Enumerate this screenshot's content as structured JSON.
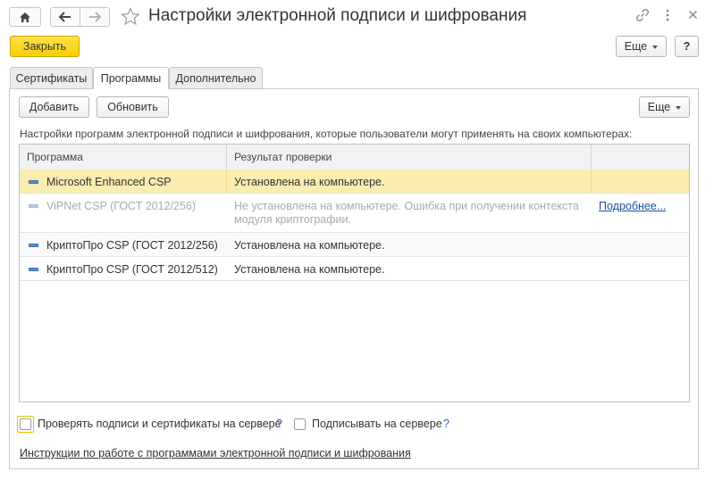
{
  "window": {
    "title": "Настройки электронной подписи и шифрования",
    "close_button": "Закрыть",
    "more_button": "Еще",
    "help_button": "?"
  },
  "tabs": [
    {
      "label": "Сертификаты",
      "active": false
    },
    {
      "label": "Программы",
      "active": true
    },
    {
      "label": "Дополнительно",
      "active": false
    }
  ],
  "toolbar": {
    "add_label": "Добавить",
    "refresh_label": "Обновить",
    "more_label": "Еще"
  },
  "description": "Настройки программ электронной подписи и шифрования, которые пользователи могут применять на своих компьютерах:",
  "table": {
    "columns": [
      "Программа",
      "Результат проверки",
      ""
    ],
    "rows": [
      {
        "program": "Microsoft Enhanced CSP",
        "result": "Установлена на компьютере.",
        "link": "",
        "selected": true,
        "dim": false
      },
      {
        "program": "ViPNet CSP (ГОСТ 2012/256)",
        "result": "Не установлена на компьютере. Ошибка при получении контекста модуля криптографии.",
        "link": "Подробнее...",
        "selected": false,
        "dim": true
      },
      {
        "program": "КриптоПро CSP (ГОСТ 2012/256)",
        "result": "Установлена на компьютере.",
        "link": "",
        "selected": false,
        "dim": false
      },
      {
        "program": "КриптоПро CSP (ГОСТ 2012/512)",
        "result": "Установлена на компьютере.",
        "link": "",
        "selected": false,
        "dim": false
      }
    ]
  },
  "options": {
    "check_on_server_label": "Проверять подписи и сертификаты на сервере",
    "check_on_server_help": "?",
    "sign_on_server_label": "Подписывать на сервере",
    "sign_on_server_help": "?"
  },
  "footer": {
    "instructions_link": "Инструкции по работе с программами электронной подписи и шифрования"
  },
  "colors": {
    "accent_yellow": "#f8cf00",
    "selected_row": "#fbecb0",
    "link": "#1a4fa0"
  }
}
